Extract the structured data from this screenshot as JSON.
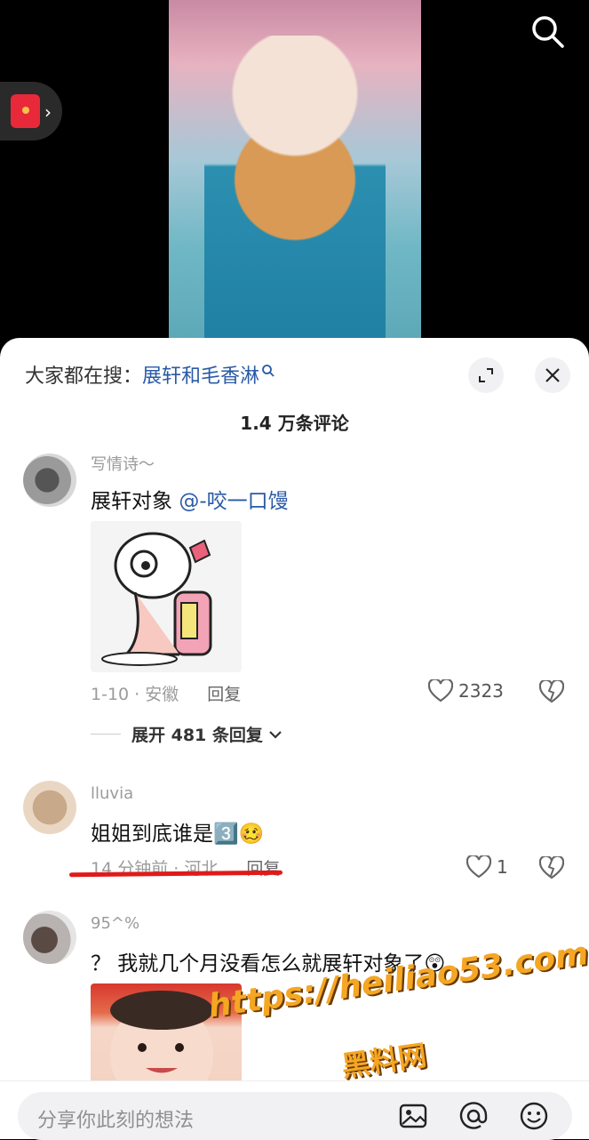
{
  "search_bar": {
    "prefix": "大家都在搜：",
    "query": "展轩和毛香淋",
    "query_icon": "search-small-icon"
  },
  "comments_header": {
    "count_label": "1.4 万条评论"
  },
  "comments": [
    {
      "username": "写情诗～",
      "text_plain": "展轩对象 ",
      "mention": "@-咬一口馒",
      "meta": "1-10 · 安徽",
      "reply_label": "回复",
      "likes": "2323",
      "expand_label": "展开 481 条回复"
    },
    {
      "username": "lluvia",
      "text": "姐姐到底谁是",
      "emoji": "3️⃣🥴",
      "meta": "14 分钟前 · 河北",
      "reply_label": "回复",
      "likes": "1"
    },
    {
      "username": "95^%",
      "text": "？ 我就几个月没看怎么就展轩对象了",
      "emoji": "😲"
    }
  ],
  "watermark": {
    "line1": "https://heiliao53.com",
    "line2": "黑料网"
  },
  "input": {
    "placeholder": "分享你此刻的想法"
  },
  "colors": {
    "accent_link": "#2a5aa6",
    "annotation_red": "#e01a1a",
    "watermark_orange": "#f5a623"
  }
}
